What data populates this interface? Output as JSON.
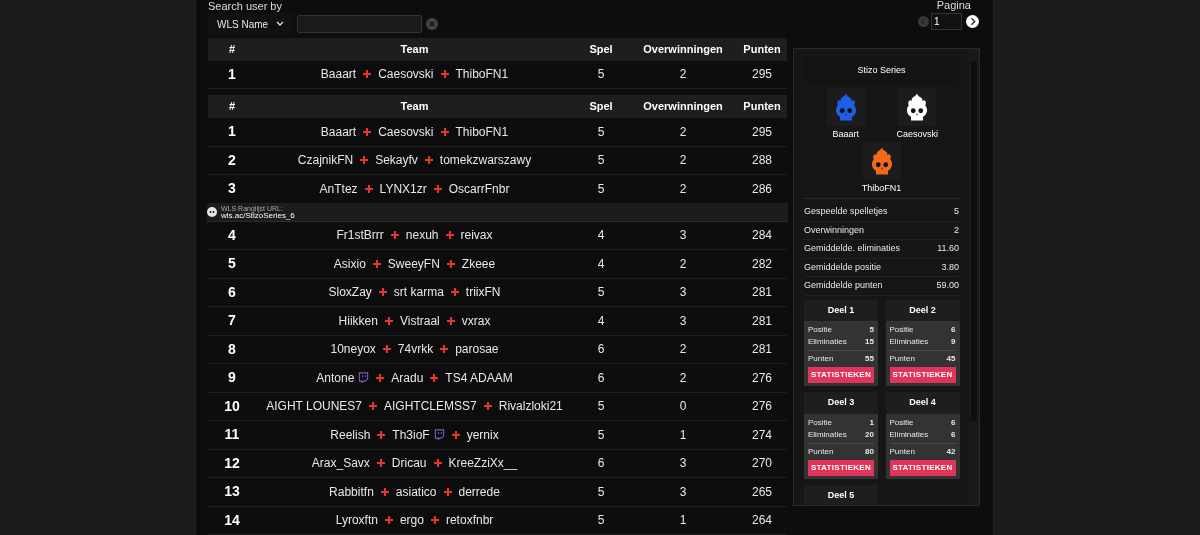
{
  "search": {
    "label": "Search user by",
    "filter": "WLS Name"
  },
  "pagination": {
    "label": "Pagina",
    "value": "1"
  },
  "pinned": {
    "columns": [
      "#",
      "Team",
      "Spel",
      "Overwinningen",
      "Punten"
    ],
    "rows": [
      {
        "kind": "team",
        "rank": "1",
        "members": [
          {
            "name": "Baaart",
            "stream": false
          },
          {
            "name": "Caesovski",
            "stream": false
          },
          {
            "name": "ThiboFN1",
            "stream": false
          }
        ],
        "games": "5",
        "wins": "2",
        "points": "295"
      }
    ]
  },
  "table": {
    "columns": [
      "#",
      "Team",
      "Spel",
      "Overwinningen",
      "Punten"
    ],
    "rows": [
      {
        "kind": "team",
        "rank": "1",
        "members": [
          {
            "name": "Baaart",
            "stream": false
          },
          {
            "name": "Caesovski",
            "stream": false
          },
          {
            "name": "ThiboFN1",
            "stream": false
          }
        ],
        "games": "5",
        "wins": "2",
        "points": "295"
      },
      {
        "kind": "team",
        "rank": "2",
        "members": [
          {
            "name": "CzajnikFN",
            "stream": false
          },
          {
            "name": "Sekayfv",
            "stream": false
          },
          {
            "name": "tomekzwarszawy",
            "stream": false
          }
        ],
        "games": "5",
        "wins": "2",
        "points": "288"
      },
      {
        "kind": "team",
        "rank": "3",
        "members": [
          {
            "name": "AnTtez",
            "stream": false
          },
          {
            "name": "LYNX1zr",
            "stream": false
          },
          {
            "name": "OscarrFnbr",
            "stream": false
          }
        ],
        "games": "5",
        "wins": "2",
        "points": "286"
      },
      {
        "kind": "banner",
        "label": "WLS Ranglijst URL:",
        "url": "wls.ac/StizoSeries_6"
      },
      {
        "kind": "team",
        "rank": "4",
        "members": [
          {
            "name": "Fr1stBrrr",
            "stream": false
          },
          {
            "name": "nexuh",
            "stream": false
          },
          {
            "name": "reivax",
            "stream": false
          }
        ],
        "games": "4",
        "wins": "3",
        "points": "284"
      },
      {
        "kind": "team",
        "rank": "5",
        "members": [
          {
            "name": "Asixio",
            "stream": false
          },
          {
            "name": "SweeyFN",
            "stream": false
          },
          {
            "name": "Zkeee",
            "stream": false
          }
        ],
        "games": "4",
        "wins": "2",
        "points": "282"
      },
      {
        "kind": "team",
        "rank": "6",
        "members": [
          {
            "name": "SloxZay",
            "stream": false
          },
          {
            "name": "srt karma",
            "stream": false
          },
          {
            "name": "triixFN",
            "stream": false
          }
        ],
        "games": "5",
        "wins": "3",
        "points": "281"
      },
      {
        "kind": "team",
        "rank": "7",
        "members": [
          {
            "name": "Hiikken",
            "stream": false
          },
          {
            "name": "Vistraal",
            "stream": false
          },
          {
            "name": "vxrax",
            "stream": false
          }
        ],
        "games": "4",
        "wins": "3",
        "points": "281"
      },
      {
        "kind": "team",
        "rank": "8",
        "members": [
          {
            "name": "10neyox",
            "stream": false
          },
          {
            "name": "74vrkk",
            "stream": false
          },
          {
            "name": "parosae",
            "stream": false
          }
        ],
        "games": "6",
        "wins": "2",
        "points": "281"
      },
      {
        "kind": "team",
        "rank": "9",
        "members": [
          {
            "name": "Antone",
            "stream": true
          },
          {
            "name": "Aradu",
            "stream": false
          },
          {
            "name": "TS4 ADAAM",
            "stream": false
          }
        ],
        "games": "6",
        "wins": "2",
        "points": "276"
      },
      {
        "kind": "team",
        "rank": "10",
        "members": [
          {
            "name": "AIGHT LOUNES7",
            "stream": false
          },
          {
            "name": "AIGHTCLEMSS7",
            "stream": false
          },
          {
            "name": "Rivalzloki21",
            "stream": false
          }
        ],
        "games": "5",
        "wins": "0",
        "points": "276"
      },
      {
        "kind": "team",
        "rank": "11",
        "members": [
          {
            "name": "Reelish",
            "stream": false
          },
          {
            "name": "Th3ioF",
            "stream": true
          },
          {
            "name": "yernix",
            "stream": false
          }
        ],
        "games": "5",
        "wins": "1",
        "points": "274"
      },
      {
        "kind": "team",
        "rank": "12",
        "members": [
          {
            "name": "Arax_Savx",
            "stream": false
          },
          {
            "name": "Dricau",
            "stream": false
          },
          {
            "name": "KreeZziXx__",
            "stream": false
          }
        ],
        "games": "6",
        "wins": "3",
        "points": "270"
      },
      {
        "kind": "team",
        "rank": "13",
        "members": [
          {
            "name": "Rabbitfn",
            "stream": false
          },
          {
            "name": "asiatico",
            "stream": false
          },
          {
            "name": "derrede",
            "stream": false
          }
        ],
        "games": "5",
        "wins": "3",
        "points": "265"
      },
      {
        "kind": "team",
        "rank": "14",
        "members": [
          {
            "name": "Lyroxftn",
            "stream": false
          },
          {
            "name": "ergo",
            "stream": false
          },
          {
            "name": "retoxfnbr",
            "stream": false
          }
        ],
        "games": "5",
        "wins": "1",
        "points": "264"
      }
    ]
  },
  "panel": {
    "title": "Stizo Series",
    "players": [
      {
        "name": "Baaart",
        "color": "#1f5fe8"
      },
      {
        "name": "Caesovski",
        "color": "#ffffff"
      },
      {
        "name": "ThiboFN1",
        "color": "#f26a1b"
      }
    ],
    "stats": [
      {
        "label": "Gespeelde spelletjes",
        "value": "5"
      },
      {
        "label": "Overwinningen",
        "value": "2"
      },
      {
        "label": "Gemiddelde. eliminaties",
        "value": "11.60"
      },
      {
        "label": "Gemiddelde positie",
        "value": "3.80"
      },
      {
        "label": "Gemiddelde punten",
        "value": "59.00"
      }
    ],
    "parts": [
      {
        "title": "Deel 1",
        "rows": [
          {
            "label": "Positie",
            "value": "5"
          },
          {
            "label": "Eliminaties",
            "value": "15"
          },
          {
            "label": "Punten",
            "value": "55"
          }
        ],
        "button": "STATISTIEKEN"
      },
      {
        "title": "Deel 2",
        "rows": [
          {
            "label": "Positie",
            "value": "6"
          },
          {
            "label": "Eliminaties",
            "value": "9"
          },
          {
            "label": "Punten",
            "value": "45"
          }
        ],
        "button": "STATISTIEKEN"
      },
      {
        "title": "Deel 3",
        "rows": [
          {
            "label": "Positie",
            "value": "1"
          },
          {
            "label": "Eliminaties",
            "value": "20"
          },
          {
            "label": "Punten",
            "value": "80"
          }
        ],
        "button": "STATISTIEKEN"
      },
      {
        "title": "Deel 4",
        "rows": [
          {
            "label": "Positie",
            "value": "6"
          },
          {
            "label": "Eliminaties",
            "value": "6"
          },
          {
            "label": "Punten",
            "value": "42"
          }
        ],
        "button": "STATISTIEKEN"
      },
      {
        "title": "Deel 5"
      }
    ]
  }
}
